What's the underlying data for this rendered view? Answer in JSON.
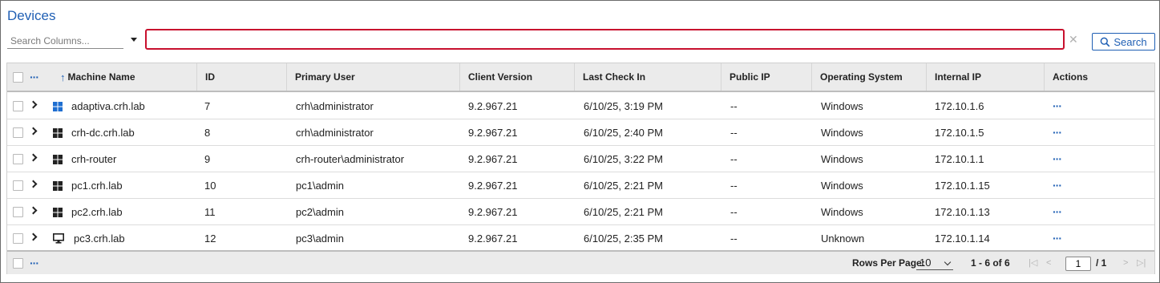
{
  "page": {
    "title": "Devices"
  },
  "search": {
    "columns_placeholder": "Search Columns...",
    "query": "",
    "clear_icon": "close-icon",
    "button_label": "Search"
  },
  "table": {
    "sort_column": "Machine Name",
    "sort_direction": "ascending",
    "columns": [
      "Machine Name",
      "ID",
      "Primary User",
      "Client Version",
      "Last Check In",
      "Public IP",
      "Operating System",
      "Internal IP",
      "Actions"
    ],
    "rows": [
      {
        "os_icon": "windows-icon",
        "machine": "adaptiva.crh.lab",
        "id": "7",
        "user": "crh\\administrator",
        "client": "9.2.967.21",
        "checkin": "6/10/25, 3:19 PM",
        "public_ip": "--",
        "os": "Windows",
        "internal_ip": "172.10.1.6",
        "actions": "···"
      },
      {
        "os_icon": "windows-icon",
        "machine": "crh-dc.crh.lab",
        "id": "8",
        "user": "crh\\administrator",
        "client": "9.2.967.21",
        "checkin": "6/10/25, 2:40 PM",
        "public_ip": "--",
        "os": "Windows",
        "internal_ip": "172.10.1.5",
        "actions": "···"
      },
      {
        "os_icon": "windows-icon",
        "machine": "crh-router",
        "id": "9",
        "user": "crh-router\\administrator",
        "client": "9.2.967.21",
        "checkin": "6/10/25, 3:22 PM",
        "public_ip": "--",
        "os": "Windows",
        "internal_ip": "172.10.1.1",
        "actions": "···"
      },
      {
        "os_icon": "windows-icon",
        "machine": "pc1.crh.lab",
        "id": "10",
        "user": "pc1\\admin",
        "client": "9.2.967.21",
        "checkin": "6/10/25, 2:21 PM",
        "public_ip": "--",
        "os": "Windows",
        "internal_ip": "172.10.1.15",
        "actions": "···"
      },
      {
        "os_icon": "windows-icon",
        "machine": "pc2.crh.lab",
        "id": "11",
        "user": "pc2\\admin",
        "client": "9.2.967.21",
        "checkin": "6/10/25, 2:21 PM",
        "public_ip": "--",
        "os": "Windows",
        "internal_ip": "172.10.1.13",
        "actions": "···"
      },
      {
        "os_icon": "monitor-icon",
        "machine": "pc3.crh.lab",
        "id": "12",
        "user": "pc3\\admin",
        "client": "9.2.967.21",
        "checkin": "6/10/25, 2:35 PM",
        "public_ip": "--",
        "os": "Unknown",
        "internal_ip": "172.10.1.14",
        "actions": "···"
      }
    ],
    "header_menu": "···",
    "footer_menu": "···"
  },
  "pagination": {
    "rows_per_page_label": "Rows Per Page:",
    "rows_per_page": "10",
    "range": "1 - 6 of 6",
    "current_page": "1",
    "total_pages": "/ 1"
  },
  "colors": {
    "accent": "#1f5fb4",
    "search_border": "#c8102e",
    "header_bg": "#ebebeb"
  }
}
